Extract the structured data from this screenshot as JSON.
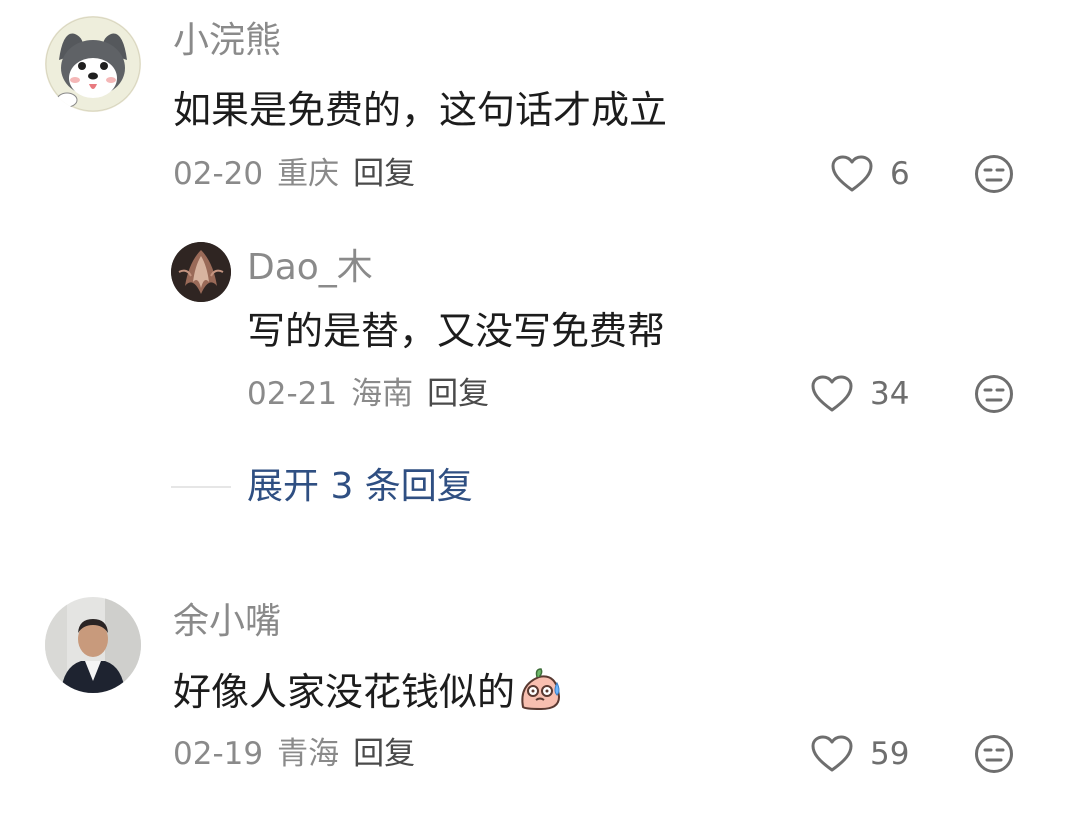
{
  "comments": [
    {
      "username": "小浣熊",
      "content": "如果是免费的，这句话才成立",
      "date": "02-20",
      "location": "重庆",
      "reply_label": "回复",
      "likes": "6",
      "avatar_icon": "dog-avatar"
    },
    {
      "username": "余小嘴",
      "content": "好像人家没花钱似的",
      "content_emoji": "sweat-emoji",
      "date": "02-19",
      "location": "青海",
      "reply_label": "回复",
      "likes": "59",
      "avatar_icon": "man-portrait-avatar"
    }
  ],
  "sub_reply": {
    "username": "Dao_木",
    "content": "写的是替，又没写免费帮",
    "date": "02-21",
    "location": "海南",
    "reply_label": "回复",
    "likes": "34",
    "avatar_icon": "dark-art-avatar"
  },
  "expand": {
    "label": "展开 3 条回复"
  },
  "colors": {
    "link": "#2f4f82",
    "meta": "#8a8a8a",
    "text": "#1c1c1c"
  }
}
